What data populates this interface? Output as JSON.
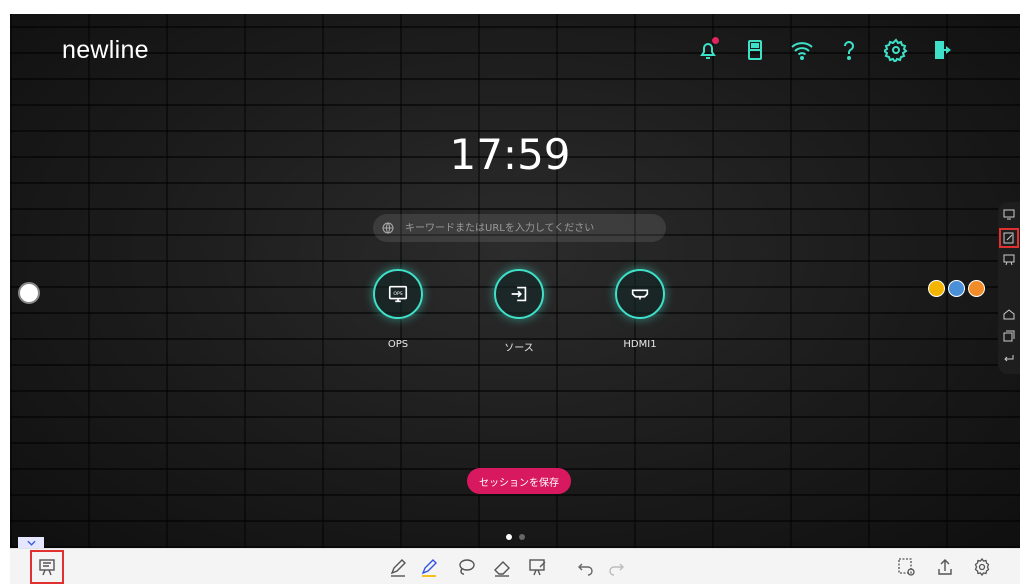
{
  "brand": {
    "logo_text": "newline"
  },
  "top_icons": [
    "bell-icon",
    "usb-icon",
    "wifi-icon",
    "help-icon",
    "settings-icon",
    "exit-icon"
  ],
  "clock": {
    "time": "17:59"
  },
  "search": {
    "placeholder": "キーワードまたはURLを入力してください"
  },
  "apps": [
    {
      "label": "OPS",
      "icon": "ops-icon"
    },
    {
      "label": "ソース",
      "icon": "source-icon"
    },
    {
      "label": "HDMI1",
      "icon": "hdmi-icon"
    }
  ],
  "session": {
    "save_label": "セッションを保存"
  },
  "pager": {
    "pages": 2,
    "current": 1
  },
  "colors": {
    "accent": "#3ee0c8",
    "save": "#d9195f",
    "highlight": "#e03030"
  }
}
